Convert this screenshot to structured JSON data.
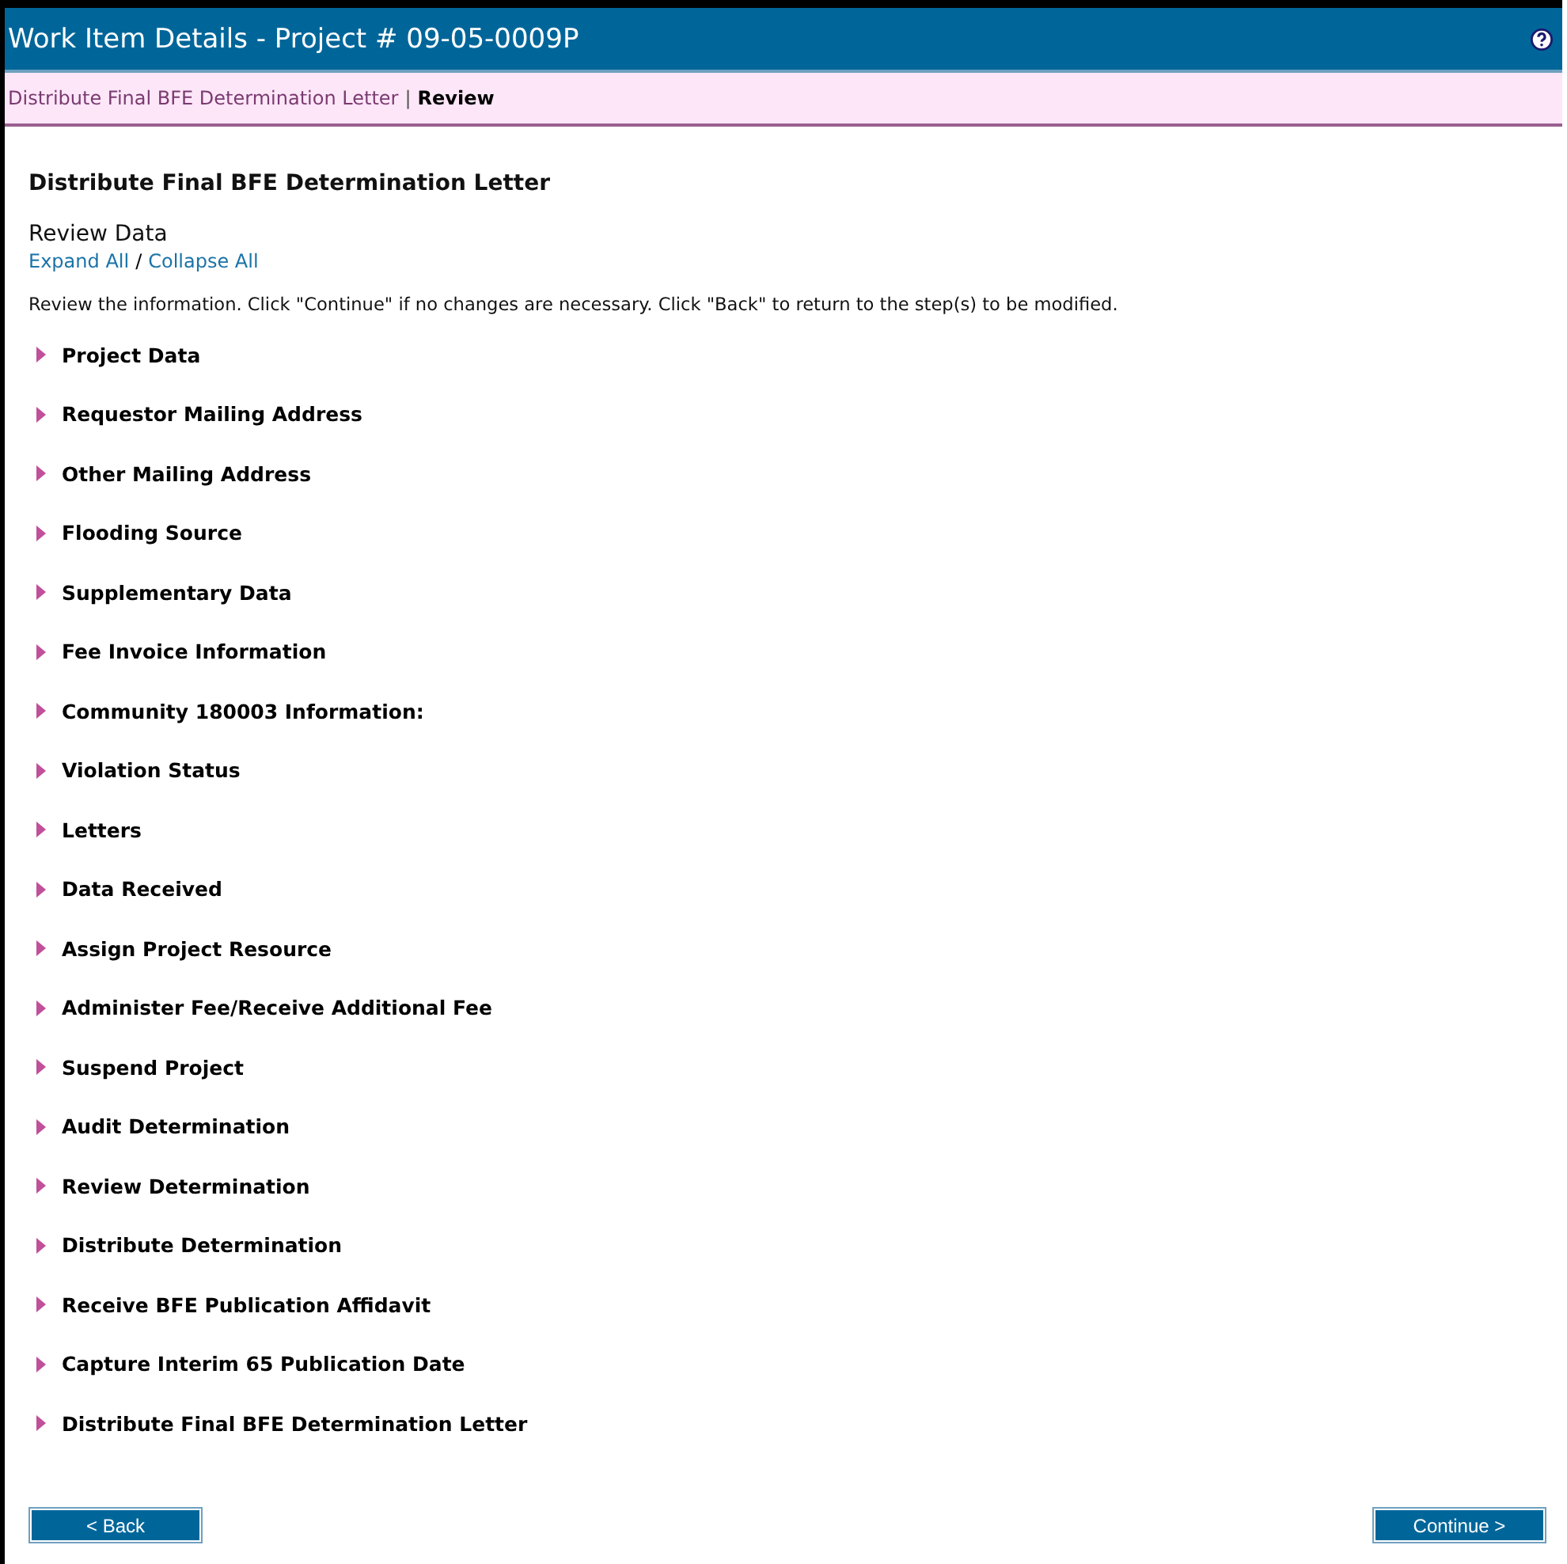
{
  "window": {
    "title": "Work Item Details - Project # 09-05-0009P"
  },
  "breadcrumb": {
    "trail": "Distribute Final BFE Determination Letter",
    "separator": "|",
    "current": "Review"
  },
  "heading": "Distribute Final BFE Determination Letter",
  "subheading": "Review Data",
  "expand_all": "Expand All",
  "divider": "/",
  "collapse_all": "Collapse All",
  "instructions": "Review the information. Click \"Continue\" if no changes are necessary. Click \"Back\" to return to the step(s) to be modified.",
  "sections": [
    {
      "label": "Project Data",
      "expanded": false
    },
    {
      "label": "Requestor Mailing Address",
      "expanded": false
    },
    {
      "label": "Other Mailing Address",
      "expanded": false
    },
    {
      "label": "Flooding Source",
      "expanded": false
    },
    {
      "label": "Supplementary Data",
      "expanded": false
    },
    {
      "label": "Fee Invoice Information",
      "expanded": false
    },
    {
      "label": "Community 180003 Information:",
      "expanded": false
    },
    {
      "label": "Violation Status",
      "expanded": false
    },
    {
      "label": "Letters",
      "expanded": false
    },
    {
      "label": "Data Received",
      "expanded": false
    },
    {
      "label": "Assign Project Resource",
      "expanded": false
    },
    {
      "label": "Administer Fee/Receive Additional Fee",
      "expanded": false
    },
    {
      "label": "Suspend Project",
      "expanded": false
    },
    {
      "label": "Audit Determination",
      "expanded": false
    },
    {
      "label": "Review Determination",
      "expanded": false
    },
    {
      "label": "Distribute Determination",
      "expanded": false
    },
    {
      "label": "Receive BFE Publication Affidavit",
      "expanded": false
    },
    {
      "label": "Capture Interim 65 Publication Date",
      "expanded": false
    },
    {
      "label": "Distribute Final BFE Determination Letter",
      "expanded": false
    }
  ],
  "buttons": [
    {
      "label": "< Back"
    },
    {
      "label": "Continue >"
    }
  ]
}
